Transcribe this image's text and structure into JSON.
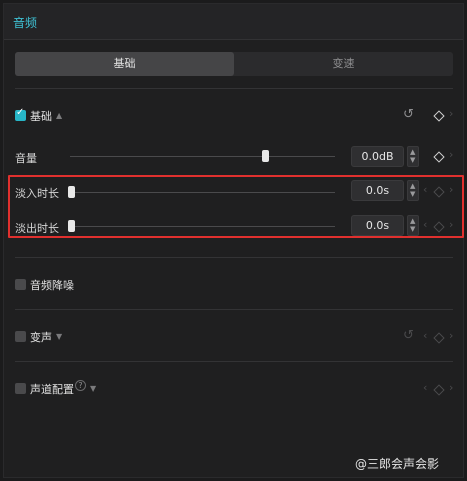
{
  "panel": {
    "title": "音频"
  },
  "tabs": [
    {
      "label": "基础",
      "active": true
    },
    {
      "label": "变速",
      "active": false
    }
  ],
  "sections": {
    "basic": {
      "label": "基础",
      "checked": true
    },
    "noise_reduction": {
      "label": "音频降噪",
      "checked": false
    },
    "voice_change": {
      "label": "变声",
      "checked": false
    },
    "channel": {
      "label": "声道配置",
      "checked": false
    }
  },
  "params": {
    "volume": {
      "label": "音量",
      "value": "0.0dB",
      "slider_fraction": 0.74
    },
    "fade_in": {
      "label": "淡入时长",
      "value": "0.0s",
      "slider_fraction": 0.0
    },
    "fade_out": {
      "label": "淡出时长",
      "value": "0.0s",
      "slider_fraction": 0.0
    }
  },
  "icons": {
    "reset": "↺",
    "help": "?",
    "left": "‹",
    "right": "›",
    "caret_up": "▲",
    "caret_down": "▼",
    "spin_up": "▲",
    "spin_down": "▼"
  },
  "colors": {
    "accent": "#27b6c8",
    "title": "#3fc3d6",
    "highlight": "#e0302e"
  },
  "watermark": "@三郎会声会影"
}
